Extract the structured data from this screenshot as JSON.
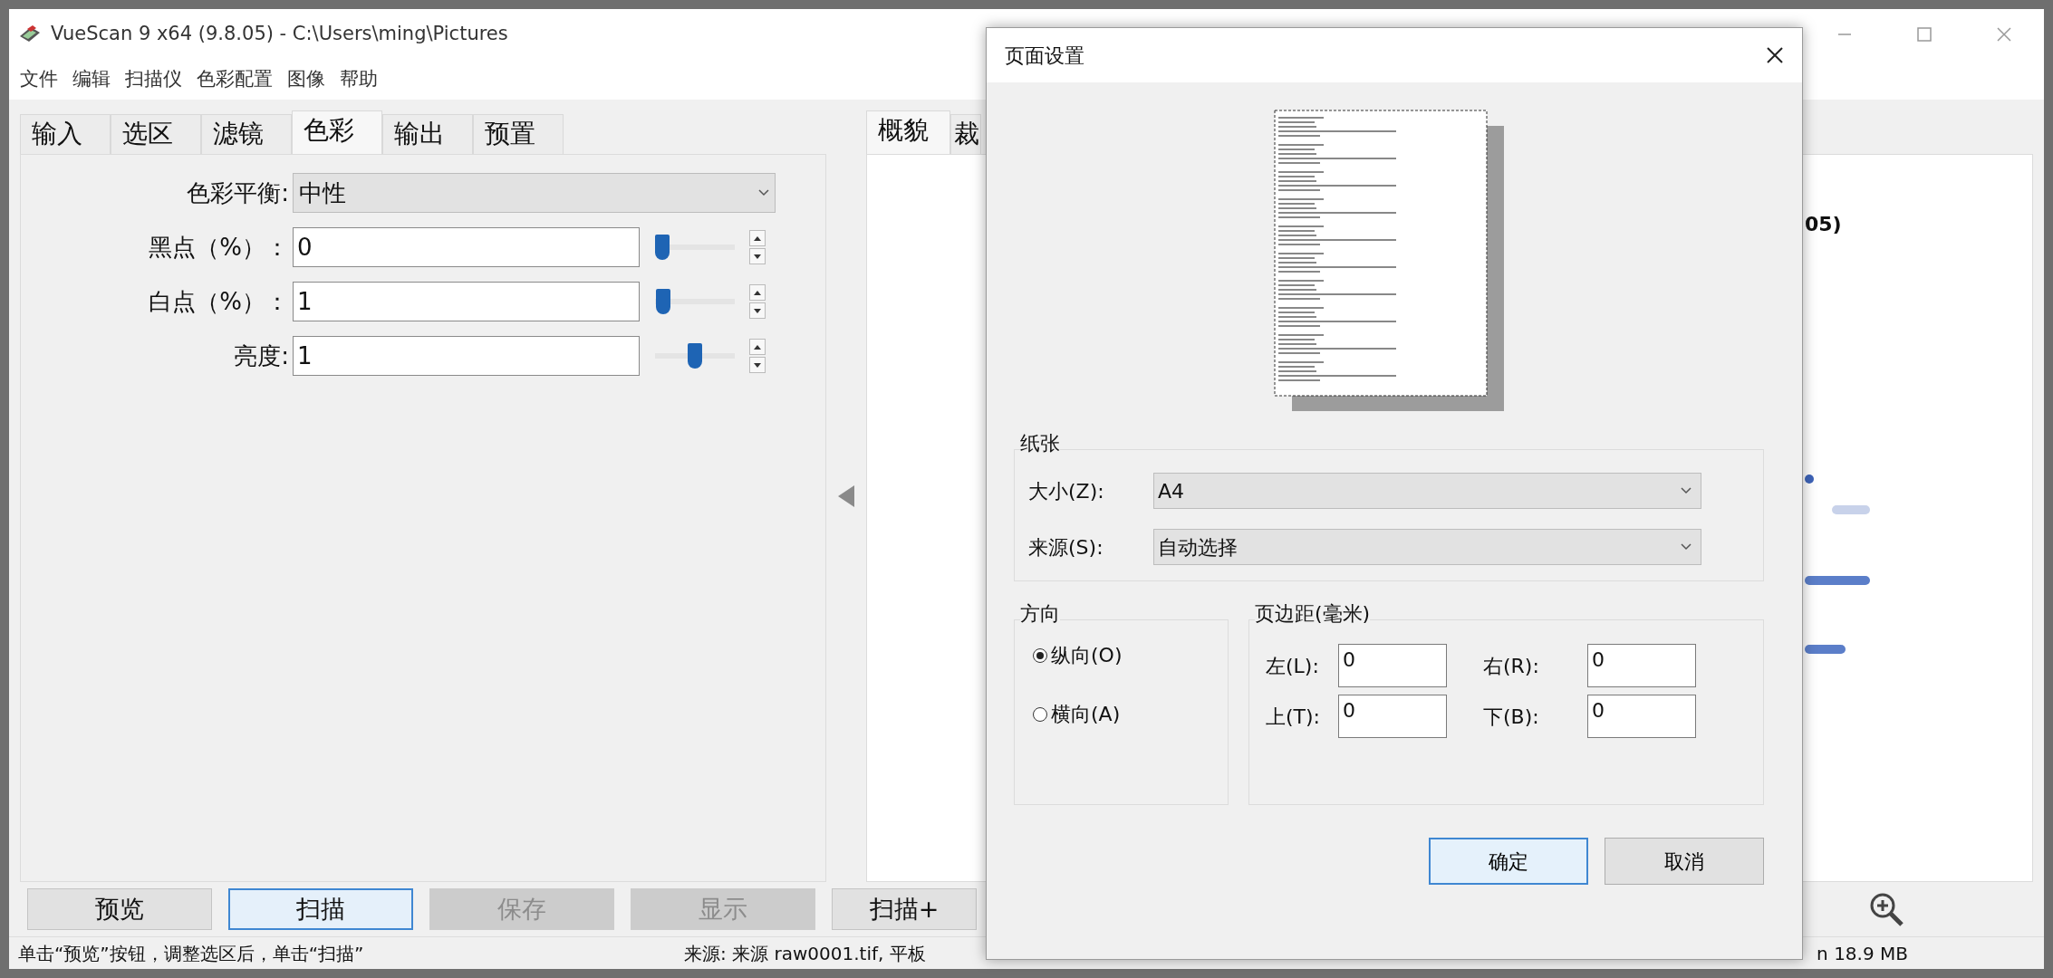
{
  "window": {
    "title": "VueScan 9 x64 (9.8.05) - C:\\Users\\ming\\Pictures"
  },
  "menu": [
    "文件",
    "编辑",
    "扫描仪",
    "色彩配置",
    "图像",
    "帮助"
  ],
  "tabs": [
    {
      "label": "输入",
      "selected": false
    },
    {
      "label": "选区",
      "selected": false
    },
    {
      "label": "滤镜",
      "selected": false
    },
    {
      "label": "色彩",
      "selected": true
    },
    {
      "label": "输出",
      "selected": false
    },
    {
      "label": "预置",
      "selected": false
    }
  ],
  "color_settings": [
    {
      "kind": "dropdown",
      "label": "色彩平衡:",
      "value": "中性"
    },
    {
      "kind": "number",
      "label": "黑点（%）：",
      "value": "0",
      "level": 0
    },
    {
      "kind": "number",
      "label": "白点（%）：",
      "value": "1",
      "level": 0.02
    },
    {
      "kind": "number",
      "label": "亮度:",
      "value": "1",
      "level": 0.5
    }
  ],
  "right_tabs": [
    {
      "label": "概貌",
      "selected": true
    },
    {
      "label": "裁",
      "selected": false
    }
  ],
  "right_panel": {
    "partial_text": "05)"
  },
  "buttons": [
    {
      "label": "预览",
      "disabled": false,
      "focused": false
    },
    {
      "label": "扫描",
      "disabled": false,
      "focused": true
    },
    {
      "label": "保存",
      "disabled": true,
      "focused": false
    },
    {
      "label": "显示",
      "disabled": true,
      "focused": false
    },
    {
      "label": "扫描+",
      "disabled": false,
      "focused": false
    }
  ],
  "status_bar": {
    "hint": "单击“预览”按钮，调整选区后，单击“扫描”",
    "source": "来源: 来源 raw0001.tif, 平板",
    "size": "n 18.9 MB"
  },
  "dialog": {
    "title": "页面设置",
    "paper": {
      "heading": "纸张",
      "fields": [
        {
          "label": "大小(Z):",
          "value": "A4"
        },
        {
          "label": "来源(S):",
          "value": "自动选择"
        }
      ]
    },
    "orientation": {
      "heading": "方向",
      "options": [
        {
          "label": "纵向(O)",
          "selected": true
        },
        {
          "label": "横向(A)",
          "selected": false
        }
      ]
    },
    "margins": {
      "heading": "页边距(毫米)",
      "fields": [
        {
          "label": "左(L):",
          "value": "0"
        },
        {
          "label": "右(R):",
          "value": "0"
        },
        {
          "label": "上(T):",
          "value": "0"
        },
        {
          "label": "下(B):",
          "value": "0"
        }
      ]
    },
    "buttons": [
      {
        "label": "确定",
        "focused": true
      },
      {
        "label": "取消",
        "focused": false
      }
    ]
  }
}
